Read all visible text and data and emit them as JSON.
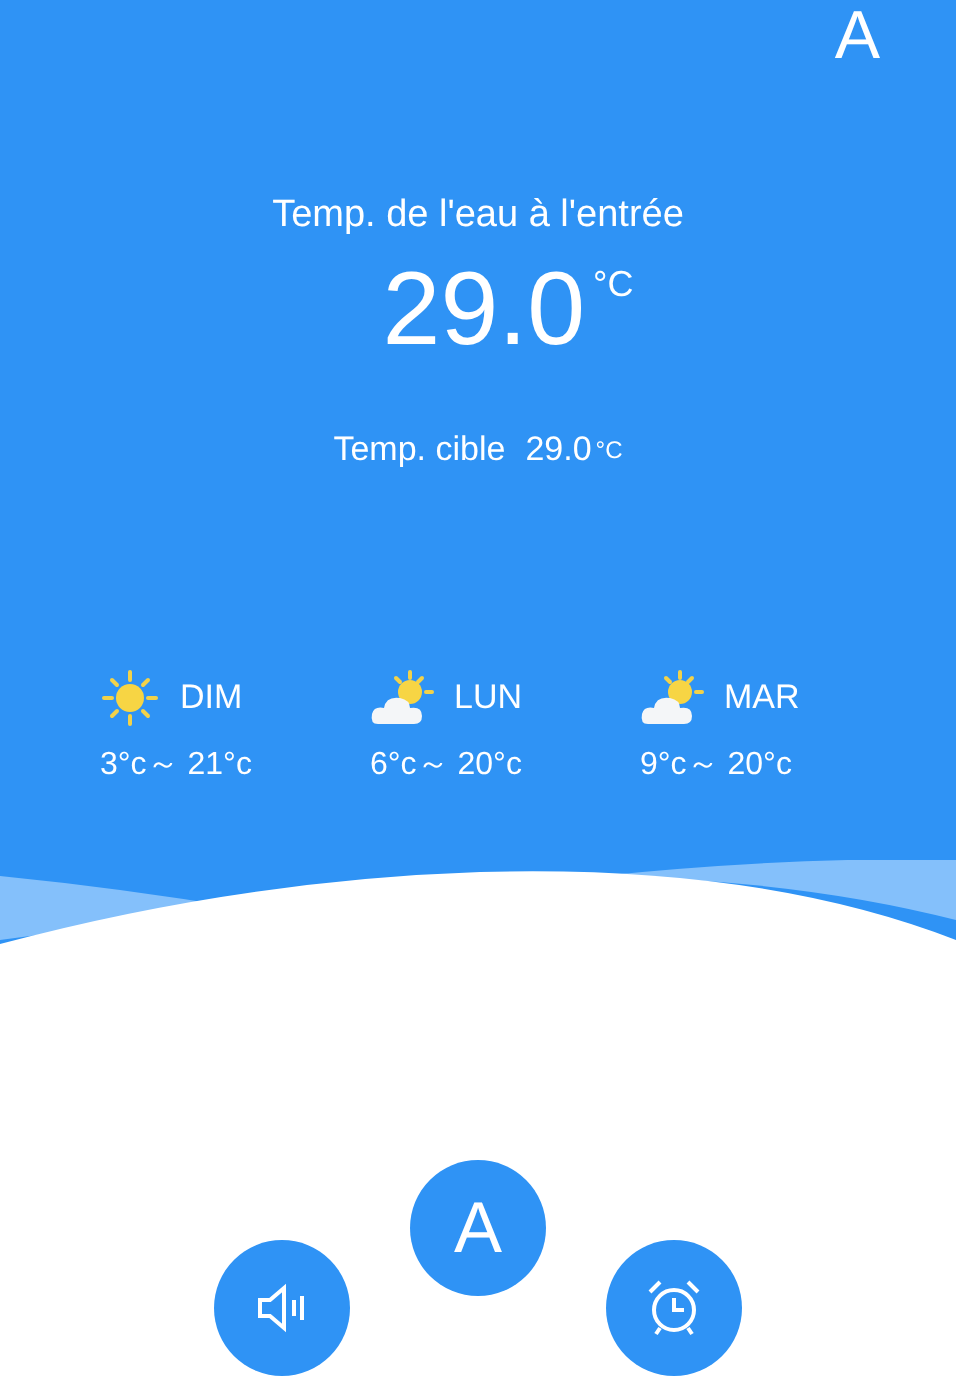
{
  "mode_letter": "A",
  "inlet": {
    "label": "Temp. de l'eau à l'entrée",
    "value": "29.0",
    "unit": "°C"
  },
  "target": {
    "label": "Temp. cible",
    "value": "29.0",
    "unit": "°C"
  },
  "forecast": [
    {
      "kind": "sunny",
      "day": "DIM",
      "range": "3°c～ 21°c"
    },
    {
      "kind": "partly_cloudy",
      "day": "LUN",
      "range": "6°c～ 20°c"
    },
    {
      "kind": "partly_cloudy",
      "day": "MAR",
      "range": "9°c～ 20°c"
    }
  ],
  "buttons": [
    {
      "kind": "sound"
    },
    {
      "kind": "mode",
      "label": "A"
    },
    {
      "kind": "alarm"
    }
  ]
}
